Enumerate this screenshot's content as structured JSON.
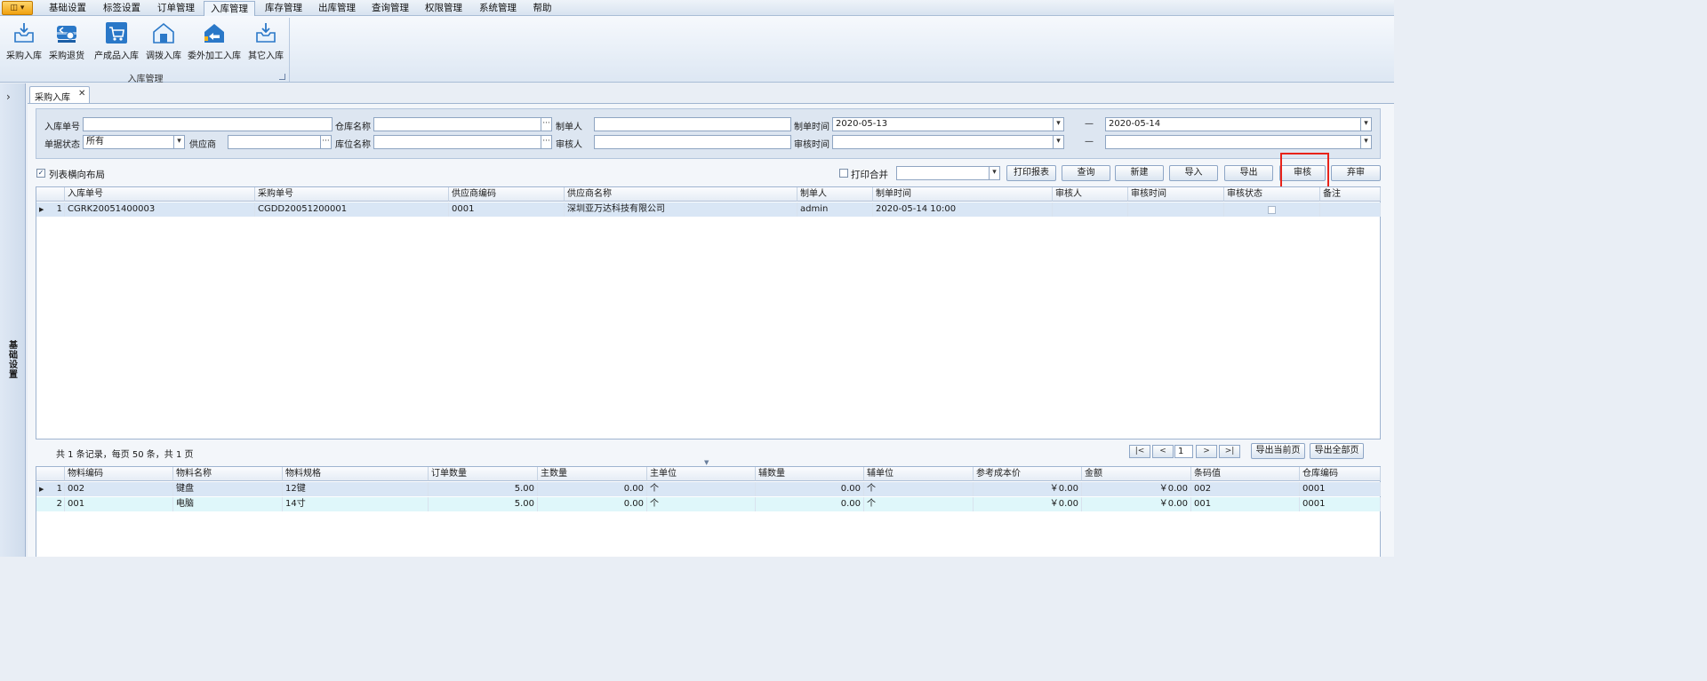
{
  "app_menu": {
    "label": "◫ ▾"
  },
  "menu_tabs": [
    "基础设置",
    "标签设置",
    "订单管理",
    "入库管理",
    "库存管理",
    "出库管理",
    "查询管理",
    "权限管理",
    "系统管理",
    "帮助"
  ],
  "active_menu_tab": "入库管理",
  "ribbon": {
    "group_label": "入库管理",
    "buttons": [
      {
        "label": "采购入库",
        "icon": "inbox-tray-icon"
      },
      {
        "label": "采购退货",
        "icon": "truck-return-icon"
      },
      {
        "label": "产成品入库",
        "icon": "cart-product-icon"
      },
      {
        "label": "调拨入库",
        "icon": "warehouse-house-icon"
      },
      {
        "label": "委外加工入库",
        "icon": "house-return-arrow-icon"
      },
      {
        "label": "其它入库",
        "icon": "inbox-download-icon"
      }
    ]
  },
  "sidebar": {
    "label": "基础设置",
    "toggle": "›"
  },
  "doc_tab": {
    "label": "采购入库",
    "close": "✕"
  },
  "filters": {
    "receipt_no_label": "入库单号",
    "receipt_no_value": "",
    "warehouse_label": "仓库名称",
    "warehouse_value": "",
    "creator_label": "制单人",
    "creator_value": "",
    "create_time_label": "制单时间",
    "create_time_from": "2020-05-13",
    "create_time_to": "2020-05-14",
    "range_dash": "—",
    "status_label": "单据状态",
    "status_value": "所有",
    "supplier_label": "供应商",
    "supplier_value": "",
    "location_label": "库位名称",
    "location_value": "",
    "auditor_label": "审核人",
    "auditor_value": "",
    "audit_time_label": "审核时间",
    "audit_time_from": "",
    "audit_time_to": "",
    "ellipsis": "···",
    "dropdown_arrow": "▾"
  },
  "toolbar": {
    "horizontal_layout_label": "列表横向布局",
    "horizontal_layout_checked": true,
    "print_merge_label": "打印合并",
    "print_merge_checked": false,
    "print_select_value": "",
    "buttons": [
      "打印报表",
      "查询",
      "新建",
      "导入",
      "导出",
      "审核",
      "弃审"
    ]
  },
  "master_grid": {
    "columns": [
      "入库单号",
      "采购单号",
      "供应商编码",
      "供应商名称",
      "制单人",
      "制单时间",
      "审核人",
      "审核时间",
      "审核状态",
      "备注"
    ],
    "rows": [
      {
        "index": "1",
        "cells": [
          "CGRK20051400003",
          "CGDD20051200001",
          "0001",
          "深圳亚万达科技有限公司",
          "admin",
          "2020-05-14 10:00",
          "",
          "",
          "",
          ""
        ],
        "audited": false
      }
    ]
  },
  "pager": {
    "summary": "共 1 条记录，每页 50 条，共 1 页",
    "first": "|<",
    "prev": "<",
    "page": "1",
    "next": ">",
    "last": ">|",
    "export_current": "导出当前页",
    "export_all": "导出全部页"
  },
  "detail_grid": {
    "columns": [
      "物料编码",
      "物料名称",
      "物料规格",
      "订单数量",
      "主数量",
      "主单位",
      "辅数量",
      "辅单位",
      "参考成本价",
      "金额",
      "条码值",
      "仓库编码"
    ],
    "rows": [
      {
        "index": "1",
        "cells": [
          "002",
          "键盘",
          "12键",
          "5.00",
          "0.00",
          "个",
          "0.00",
          "个",
          "￥0.00",
          "￥0.00",
          "002",
          "0001"
        ]
      },
      {
        "index": "2",
        "cells": [
          "001",
          "电脑",
          "14寸",
          "5.00",
          "0.00",
          "个",
          "0.00",
          "个",
          "￥0.00",
          "￥0.00",
          "001",
          "0001"
        ]
      }
    ]
  },
  "colors": {
    "highlight": "#e8231a",
    "selected_row": "#d9e6f5",
    "alt_row": "#dff7fa",
    "app_button": "#f0a10f"
  }
}
